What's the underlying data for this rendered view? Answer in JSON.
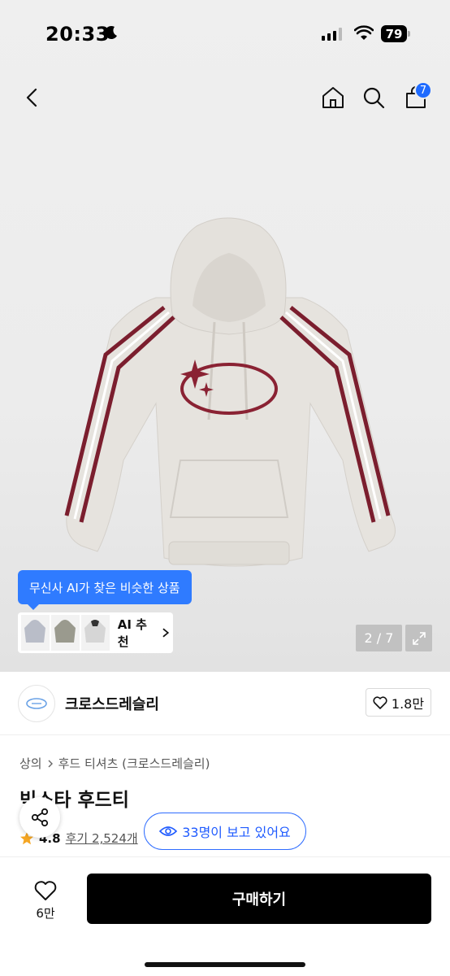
{
  "status_bar": {
    "time": "20:33",
    "battery": "79"
  },
  "nav": {
    "cart_count": "7"
  },
  "product_image": {
    "ai_tooltip": "무신사 AI가 찾은 비슷한 상품",
    "ai_recommend_label": "AI 추천",
    "page_indicator": "2 / 7"
  },
  "brand": {
    "name": "크로스드레슬리",
    "likes": "1.8만"
  },
  "breadcrumb": [
    "상의",
    "후드 티셔츠 (크로스드레슬리)"
  ],
  "product": {
    "title": "빅스타 후드티",
    "rating": "4.8",
    "reviews": "후기 2,524개"
  },
  "viewers": "33명이 보고 있어요",
  "bottom": {
    "wish_count": "6만",
    "buy_label": "구매하기"
  },
  "colors": {
    "accent_blue": "#2f7bff",
    "buy_button": "#000000",
    "star": "#f5a623",
    "stripe": "#7b1e2e"
  },
  "icons": [
    "moon-icon",
    "signal-icon",
    "wifi-icon",
    "back-icon",
    "home-icon",
    "search-icon",
    "cart-icon",
    "chevron-right-icon",
    "expand-icon",
    "heart-icon",
    "star-icon",
    "share-icon",
    "eye-icon"
  ]
}
